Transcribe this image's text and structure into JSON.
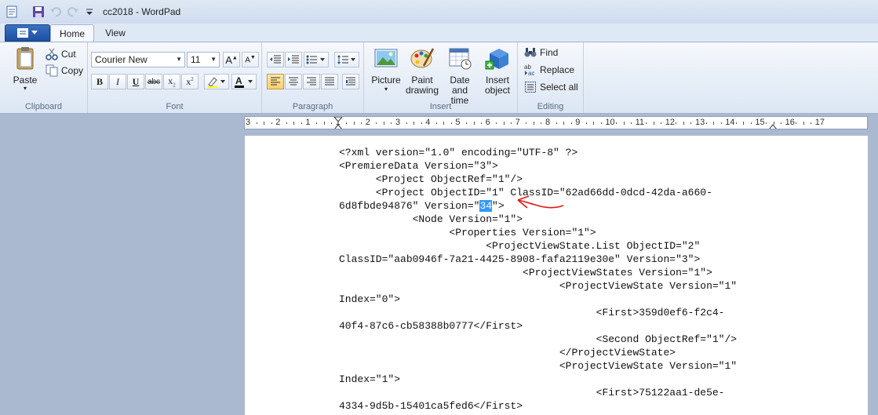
{
  "window": {
    "title": "cc2018 - WordPad"
  },
  "tabs": {
    "home": "Home",
    "view": "View"
  },
  "clipboard": {
    "paste": "Paste",
    "cut": "Cut",
    "copy": "Copy",
    "label": "Clipboard"
  },
  "font": {
    "family": "Courier New",
    "size": "11",
    "label": "Font"
  },
  "paragraph": {
    "label": "Paragraph"
  },
  "insert": {
    "picture": "Picture",
    "paint_drawing_1": "Paint",
    "paint_drawing_2": "drawing",
    "date_time_1": "Date and",
    "date_time_2": "time",
    "insert_object_1": "Insert",
    "insert_object_2": "object",
    "label": "Insert"
  },
  "editing": {
    "find": "Find",
    "replace": "Replace",
    "select_all": "Select all",
    "label": "Editing"
  },
  "ruler": {
    "numbers": [
      "3",
      "2",
      "1",
      "1",
      "2",
      "3",
      "4",
      "5",
      "6",
      "7",
      "8",
      "9",
      "10",
      "11",
      "12",
      "13",
      "14",
      "15",
      "16",
      "17"
    ]
  },
  "document": {
    "lines": [
      "<?xml version=\"1.0\" encoding=\"UTF-8\" ?>",
      "<PremiereData Version=\"3\">",
      "      <Project ObjectRef=\"1\"/>",
      "      <Project ObjectID=\"1\" ClassID=\"62ad66dd-0dcd-42da-a660-",
      "",
      "            <Node Version=\"1\">",
      "                  <Properties Version=\"1\">",
      "                        <ProjectViewState.List ObjectID=\"2\"",
      "ClassID=\"aab0946f-7a21-4425-8908-fafa2119e30e\" Version=\"3\">",
      "                              <ProjectViewStates Version=\"1\">",
      "                                    <ProjectViewState Version=\"1\"",
      "Index=\"0\">",
      "                                          <First>359d0ef6-f2c4-",
      "40f4-87c6-cb58388b0777</First>",
      "                                          <Second ObjectRef=\"1\"/>",
      "                                    </ProjectViewState>",
      "                                    <ProjectViewState Version=\"1\"",
      "Index=\"1\">",
      "                                          <First>75122aa1-de5e-",
      "4334-9d5b-15401ca5fed6</First>"
    ],
    "version_line": {
      "before": "6d8fbde94876\" Version=\"",
      "selected": "34",
      "after": "\">"
    }
  }
}
